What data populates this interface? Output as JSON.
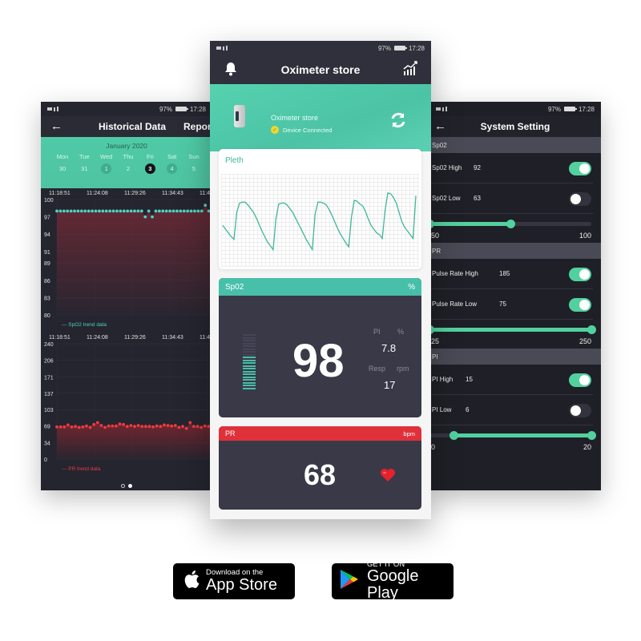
{
  "status_bar": {
    "battery": "97%",
    "time": "17:28"
  },
  "historical": {
    "back_icon": "arrow-left-icon",
    "title": "Historical Data",
    "title_next": "Repor",
    "month": "January 2020",
    "weekdays": [
      "Mon",
      "Tue",
      "Wed",
      "Thu",
      "Fri",
      "Sat",
      "Sun"
    ],
    "dates": [
      "30",
      "31",
      "1",
      "2",
      "3",
      "4",
      "5"
    ],
    "selected_date": "3",
    "spo2_chart": {
      "times": [
        "11:18:51",
        "11:24:08",
        "11:29:26",
        "11:34:43",
        "11:4"
      ],
      "y_ticks": [
        "100",
        "97",
        "94",
        "91",
        "89",
        "86",
        "83",
        "80"
      ],
      "legend": "--- SpO2 trend data"
    },
    "pr_chart": {
      "times": [
        "11:18:51",
        "11:24:08",
        "11:29:26",
        "11:34:43",
        "11:4"
      ],
      "y_ticks": [
        "240",
        "206",
        "171",
        "137",
        "103",
        "69",
        "34",
        "0"
      ],
      "legend": "--- PR trend data"
    },
    "pager": {
      "pages": 2,
      "active": 1
    }
  },
  "chart_data": [
    {
      "type": "scatter",
      "title": "SpO2 trend data",
      "x": [
        "11:18:51",
        "11:24:08",
        "11:29:26",
        "11:34:43"
      ],
      "ylim": [
        80,
        100
      ],
      "y_ticks": [
        100,
        97,
        94,
        91,
        89,
        86,
        83,
        80
      ],
      "values": [
        98,
        98,
        98,
        98,
        98,
        98,
        98,
        98,
        98,
        98,
        98,
        98,
        98,
        98,
        98,
        98,
        98,
        98,
        98,
        98,
        98,
        98,
        98,
        98,
        98,
        97,
        98,
        97,
        98,
        98,
        98,
        98,
        98,
        98,
        98,
        98,
        98,
        98,
        98,
        98,
        98,
        98,
        99,
        98,
        98
      ],
      "color": "#4fd1bd"
    },
    {
      "type": "scatter",
      "title": "PR trend data",
      "x": [
        "11:18:51",
        "11:24:08",
        "11:29:26",
        "11:34:43"
      ],
      "ylim": [
        0,
        240
      ],
      "y_ticks": [
        240,
        206,
        171,
        137,
        103,
        69,
        34,
        0
      ],
      "values": [
        67,
        67,
        67,
        71,
        67,
        68,
        66,
        67,
        69,
        66,
        72,
        76,
        70,
        66,
        69,
        69,
        69,
        73,
        72,
        68,
        70,
        68,
        70,
        68,
        68,
        68,
        67,
        69,
        68,
        71,
        70,
        69,
        70,
        66,
        68,
        64,
        76,
        68,
        68,
        66,
        69,
        68,
        66
      ],
      "color": "#f03a3e"
    },
    {
      "type": "line",
      "title": "Pleth",
      "values": [
        0.48,
        0.44,
        0.4,
        0.36,
        0.33,
        0.62,
        0.72,
        0.73,
        0.73,
        0.7,
        0.66,
        0.62,
        0.56,
        0.49,
        0.42,
        0.36,
        0.3,
        0.26,
        0.22,
        0.55,
        0.71,
        0.72,
        0.72,
        0.7,
        0.66,
        0.62,
        0.56,
        0.5,
        0.44,
        0.38,
        0.32,
        0.27,
        0.22,
        0.6,
        0.73,
        0.73,
        0.72,
        0.7,
        0.65,
        0.59,
        0.52,
        0.45,
        0.39,
        0.34,
        0.29,
        0.25,
        0.57,
        0.75,
        0.74,
        0.71,
        0.69,
        0.63,
        0.55,
        0.48,
        0.44,
        0.4,
        0.38,
        0.34,
        0.64,
        0.83,
        0.82,
        0.78,
        0.72,
        0.62,
        0.52,
        0.46,
        0.42,
        0.38,
        0.34,
        0.8
      ],
      "ylim": [
        0,
        1
      ],
      "color": "#3fb79a"
    }
  ],
  "main": {
    "title": "Oximeter store",
    "bell_icon": "bell-icon",
    "trend_icon": "signal-trend-icon",
    "device_name": "Oximeter store",
    "device_status": "Device Connected",
    "pleth_label": "Pleth",
    "spo2": {
      "label": "Sp02",
      "unit": "%",
      "value": "98",
      "level_fraction": 0.6,
      "pi_label": "PI",
      "pi_unit": "%",
      "pi_value": "7.8",
      "resp_label": "Resp",
      "resp_unit": "rpm",
      "resp_value": "17"
    },
    "pr": {
      "label": "PR",
      "unit": "bpm",
      "value": "68"
    }
  },
  "settings": {
    "title": "System Setting",
    "sections": [
      {
        "name": "Sp02",
        "rows": [
          {
            "label": "Sp02 High",
            "value": "92",
            "enabled": true
          },
          {
            "label": "Sp02 Low",
            "value": "63",
            "enabled": false
          }
        ],
        "slider": {
          "min": "50",
          "max": "100",
          "low": 50,
          "high": 75,
          "range": [
            50,
            100
          ]
        }
      },
      {
        "name": "PR",
        "rows": [
          {
            "label": "Pulse Rate High",
            "value": "185",
            "enabled": true
          },
          {
            "label": "Pulse Rate Low",
            "value": "75",
            "enabled": true
          }
        ],
        "slider": {
          "min": "25",
          "max": "250",
          "low": 25,
          "high": 250,
          "range": [
            25,
            250
          ]
        }
      },
      {
        "name": "PI",
        "rows": [
          {
            "label": "PI High",
            "value": "15",
            "enabled": true
          },
          {
            "label": "PI Low",
            "value": "6",
            "enabled": false
          }
        ],
        "slider": {
          "min": "0",
          "max": "20",
          "low": 3,
          "high": 20,
          "range": [
            0,
            20
          ]
        }
      }
    ]
  },
  "stores": {
    "apple": {
      "small": "Download on the",
      "big": "App Store"
    },
    "google": {
      "small": "GET IT ON",
      "big": "Google Play"
    }
  }
}
